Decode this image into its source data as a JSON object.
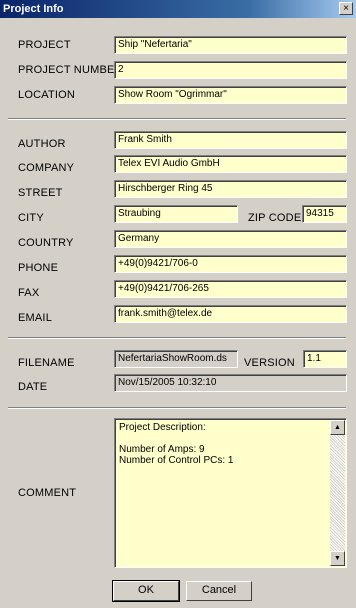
{
  "window": {
    "title": "Project Info",
    "close_glyph": "×"
  },
  "project": {
    "project_label": "PROJECT",
    "project_value": "Ship \"Nefertaria\"",
    "number_label": "PROJECT NUMBER",
    "number_value": "2",
    "location_label": "LOCATION",
    "location_value": "Show Room \"Ogrimmar\""
  },
  "author": {
    "author_label": "AUTHOR",
    "author_value": "Frank Smith",
    "company_label": "COMPANY",
    "company_value": "Telex EVI Audio GmbH",
    "street_label": "STREET",
    "street_value": "Hirschberger Ring 45",
    "city_label": "CITY",
    "city_value": "Straubing",
    "zip_label": "ZIP CODE",
    "zip_value": "94315",
    "country_label": "COUNTRY",
    "country_value": "Germany",
    "phone_label": "PHONE",
    "phone_value": "+49(0)9421/706-0",
    "fax_label": "FAX",
    "fax_value": "+49(0)9421/706-265",
    "email_label": "EMAIL",
    "email_value": "frank.smith@telex.de"
  },
  "file": {
    "filename_label": "FILENAME",
    "filename_value": "NefertariaShowRoom.ds",
    "version_label": "VERSION",
    "version_value": "1.1",
    "date_label": "DATE",
    "date_value": "Nov/15/2005  10:32:10"
  },
  "comment": {
    "label": "COMMENT",
    "text": "Project Description:\n\nNumber of Amps: 9\nNumber of Control PCs: 1"
  },
  "buttons": {
    "ok_label": "OK",
    "cancel_label": "Cancel"
  },
  "colors": {
    "field_bg": "#ffffcc",
    "dialog_bg": "#d4d0c8",
    "title_bg": "#0a246a"
  }
}
